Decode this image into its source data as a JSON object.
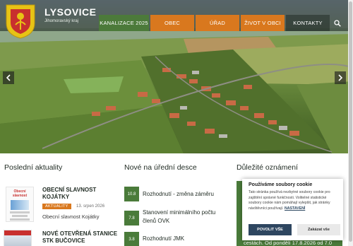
{
  "header": {
    "brand": "LYSOVICE",
    "subtitle": "Jihomoravský kraj",
    "nav": [
      {
        "label": "KANALIZACE 2025",
        "style": "green"
      },
      {
        "label": "OBEC",
        "style": "orange"
      },
      {
        "label": "ÚŘAD",
        "style": "orange"
      },
      {
        "label": "ŽIVOT V OBCI",
        "style": "orange"
      },
      {
        "label": "KONTAKTY",
        "style": "dark"
      }
    ]
  },
  "sections": {
    "news_title": "Poslední aktuality",
    "board_title": "Nové na úřední desce",
    "important_title": "Důležité oznámení"
  },
  "news": [
    {
      "title_line1": "OBECNÍ SLAVNOST",
      "title_line2": "KOJÁTKY",
      "badge": "AKTUALITY",
      "date": "13. srpen 2026",
      "subtitle": "Obecní slavnost Kojátky",
      "thumb_text": "Obecní slavnost"
    },
    {
      "title_line1": "NOVÉ OTEVŘENÁ STANICE",
      "title_line2": "STK BUČOVICE"
    }
  ],
  "board": [
    {
      "date": "10.8",
      "title_line1": "Rozhodnutí - změna záměru",
      "title_line2": ""
    },
    {
      "date": "7.8",
      "title_line1": "Stanovení minimálního počtu",
      "title_line2": "členů OVK"
    },
    {
      "date": "3.8",
      "title_line1": "Rozhodnutí JMK",
      "title_line2": ""
    }
  ],
  "important_behind_text": "cestách. Od pondělí 17.8.2026 od 7.0",
  "cookie": {
    "title": "Používáme soubory cookie",
    "text_pre": "Tato stránka používá nezbytné soubory cookie pro zajištění správné funkčnosti. Volitelné statistické soubory cookie nám pomáhají vylepšit, jak stránky návštěvníci používají. ",
    "settings_link": "NASTAVENÍ",
    "accept_label": "POVOLIT VŠE",
    "reject_label": "Zakázat vše"
  },
  "colors": {
    "green": "#4a7b3a",
    "orange": "#d9781e",
    "navy": "#2e4660"
  }
}
